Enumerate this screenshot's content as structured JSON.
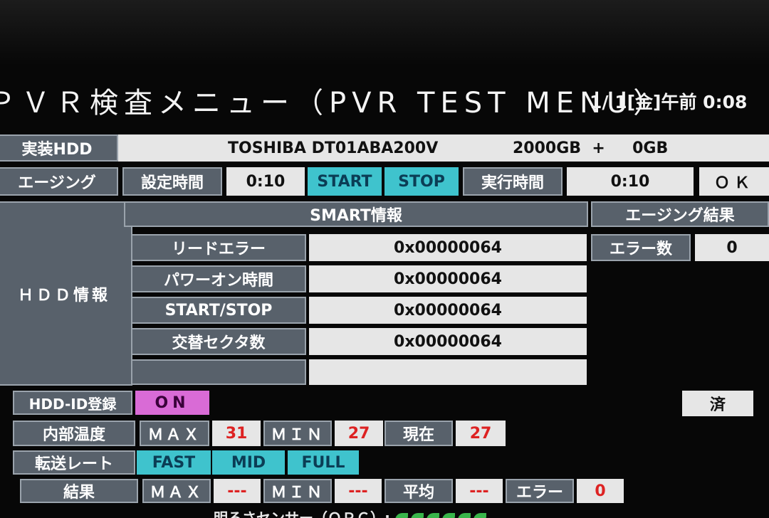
{
  "title": "ＰＶＲ検査メニュー（PVR TEST MENU）",
  "clock": "1/ 1[金]午前 0:08",
  "hdd": {
    "label": "実装HDD",
    "model": "TOSHIBA  DT01ABA200V",
    "capacity": "2000GB  +     0GB"
  },
  "aging": {
    "label": "エージング",
    "set_time_label": "設定時間",
    "set_time_value": "0:10",
    "start_label": "START",
    "stop_label": "STOP",
    "run_time_label": "実行時間",
    "run_time_value": "0:10",
    "ok_label": "ＯＫ"
  },
  "hdd_info": {
    "label": "ＨＤＤ情報",
    "smart_header": "SMART情報",
    "rows": [
      {
        "label": "リードエラー",
        "value": "0x00000064"
      },
      {
        "label": "パワーオン時間",
        "value": "0x00000064"
      },
      {
        "label": "START/STOP",
        "value": "0x00000064"
      },
      {
        "label": "交替セクタ数",
        "value": "0x00000064"
      },
      {
        "label": "",
        "value": ""
      }
    ],
    "aging_result_header": "エージング結果",
    "error_count_label": "エラー数",
    "error_count_value": "0"
  },
  "hdd_id": {
    "label": "HDD-ID登録",
    "state": "ON",
    "done_label": "済"
  },
  "temperature": {
    "label": "内部温度",
    "max_label": "ＭＡＸ",
    "max_value": "31",
    "min_label": "ＭＩＮ",
    "min_value": "27",
    "current_label": "現在",
    "current_value": "27"
  },
  "transfer_rate": {
    "label": "転送レート",
    "options": [
      "FAST",
      "MID",
      "FULL"
    ]
  },
  "result": {
    "label": "結果",
    "max_label": "ＭＡＸ",
    "max_value": "---",
    "min_label": "ＭＩＮ",
    "min_value": "---",
    "avg_label": "平均",
    "avg_value": "---",
    "error_label": "エラー",
    "error_value": "0"
  },
  "sensor": {
    "label": "明るさセンサー（ＯＰＣ）:"
  },
  "colors": {
    "label_bg": "#58616b",
    "value_bg": "#e6e6e6",
    "cyan": "#3fc3cd",
    "pink": "#d96bd6",
    "red_value": "#dd2222"
  }
}
